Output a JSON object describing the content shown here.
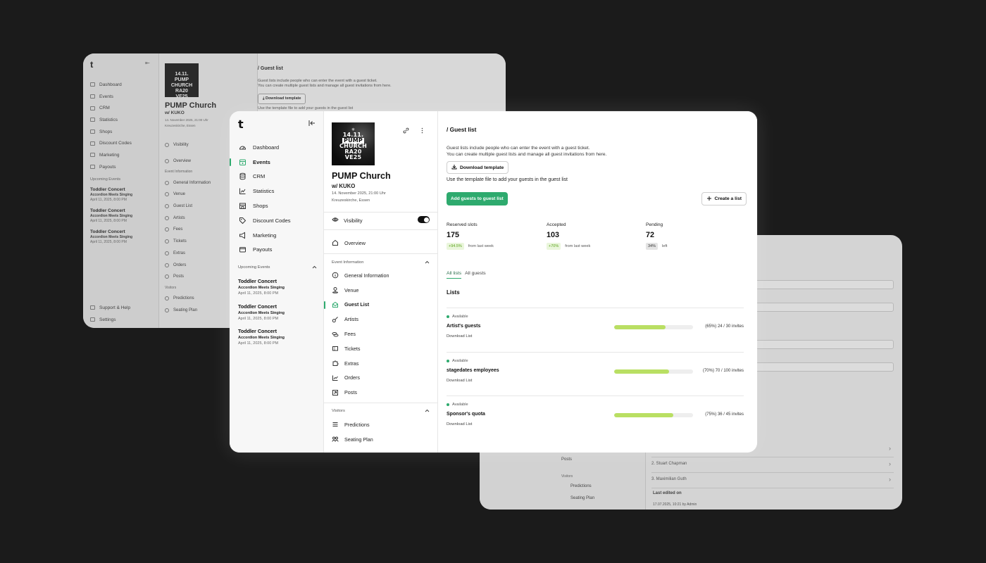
{
  "background_left": {
    "nav": [
      "Dashboard",
      "Events",
      "CRM",
      "Statistics",
      "Shops",
      "Discount Codes",
      "Marketing",
      "Payouts"
    ],
    "upcoming_heading": "Upcoming Events",
    "upcoming": [
      {
        "title": "Toddler Concert",
        "subtitle": "Accordion Meets Singing",
        "date": "April 11, 2025, 8:00 PM"
      },
      {
        "title": "Toddler Concert",
        "subtitle": "Accordion Meets Singing",
        "date": "April 11, 2025, 8:00 PM"
      },
      {
        "title": "Toddler Concert",
        "subtitle": "Accordion Meets Singing",
        "date": "April 11, 2025, 8:00 PM"
      }
    ],
    "footer": [
      "Support & Help",
      "Settings"
    ],
    "event_title": "PUMP Church",
    "event_sub": "w/ KUKO",
    "event_date": "14. November 2025, 21:00 Uhr",
    "event_place": "Kreuzeskirche, Essen",
    "event_nav": [
      "Visibility",
      "Overview",
      "Event Information",
      "General Information",
      "Venue",
      "Guest List",
      "Artists",
      "Fees",
      "Tickets",
      "Extras",
      "Orders",
      "Posts",
      "Visitors",
      "Predictions",
      "Seating Plan"
    ],
    "main_title": "/ Guest list",
    "main_desc_1": "Guest lists include people who can enter the event with a guest ticket.",
    "main_desc_2": "You can create multiple guest lists and manage all guest invitations from here.",
    "download_label": "Download template",
    "template_hint": "Use the template file to add your guests in the guest list"
  },
  "background_right": {
    "nav": [
      "Posts",
      "Visitors",
      "Predictions",
      "Seating Plan"
    ],
    "rows": [
      "2. Stuart Chapman",
      "3. Maximilian Guth"
    ],
    "last_edited_label": "Last edited on",
    "last_edited_value": "17.07.2025, 10:21 by Admin"
  },
  "sidebar": {
    "logo": "t",
    "nav": [
      {
        "label": "Dashboard",
        "icon": "dashboard-icon",
        "active": false
      },
      {
        "label": "Events",
        "icon": "calendar-icon",
        "active": true
      },
      {
        "label": "CRM",
        "icon": "database-icon",
        "active": false
      },
      {
        "label": "Statistics",
        "icon": "chart-icon",
        "active": false
      },
      {
        "label": "Shops",
        "icon": "shop-icon",
        "active": false
      },
      {
        "label": "Discount Codes",
        "icon": "tag-icon",
        "active": false
      },
      {
        "label": "Marketing",
        "icon": "megaphone-icon",
        "active": false
      },
      {
        "label": "Payouts",
        "icon": "wallet-icon",
        "active": false
      }
    ],
    "upcoming_heading": "Upcoming Events",
    "upcoming": [
      {
        "title": "Toddler Concert",
        "subtitle": "Accordion Meets Singing",
        "date": "April 11, 2025, 8:00 PM"
      },
      {
        "title": "Toddler Concert",
        "subtitle": "Accordion Meets Singing",
        "date": "April 11, 2025, 8:00 PM"
      },
      {
        "title": "Toddler Concert",
        "subtitle": "Accordion Meets Singing",
        "date": "April 11, 2025, 8:00 PM"
      }
    ]
  },
  "event": {
    "artwork_lines": [
      "14.11.",
      "PUMP",
      "CHURCH",
      "RA20",
      "VE25"
    ],
    "title": "PUMP Church",
    "subtitle": "w/ KUKO",
    "date": "14. November 2025, 21:00 Uhr",
    "place": "Kreuzeskirche, Essen",
    "visibility_label": "Visibility",
    "visibility_on": true,
    "overview_label": "Overview",
    "event_info_heading": "Event Information",
    "event_info_items": [
      {
        "label": "General Information",
        "icon": "info-icon",
        "active": false
      },
      {
        "label": "Venue",
        "icon": "location-icon",
        "active": false
      },
      {
        "label": "Guest List",
        "icon": "mail-icon",
        "active": true
      },
      {
        "label": "Artists",
        "icon": "guitar-icon",
        "active": false
      },
      {
        "label": "Fees",
        "icon": "coins-icon",
        "active": false
      },
      {
        "label": "Tickets",
        "icon": "ticket-icon",
        "active": false
      },
      {
        "label": "Extras",
        "icon": "puzzle-icon",
        "active": false
      },
      {
        "label": "Orders",
        "icon": "orders-icon",
        "active": false
      },
      {
        "label": "Posts",
        "icon": "post-icon",
        "active": false
      }
    ],
    "visitors_heading": "Visitors",
    "visitors_items": [
      {
        "label": "Predictions",
        "icon": "list-icon"
      },
      {
        "label": "Seating Plan",
        "icon": "seats-icon"
      }
    ]
  },
  "guest_list": {
    "title": "/ Guest list",
    "desc_1": "Guest lists include people who can enter the event with a guest ticket.",
    "desc_2": "You can create multiple guest lists and manage all guest invitations from here.",
    "download_label": "Download template",
    "template_hint": "Use the template file to add your guests in the guest list",
    "add_label": "Add guests to guest list",
    "create_label": "Create a list",
    "stats": [
      {
        "label": "Reserved slots",
        "value": "175",
        "badge": "+94.5%",
        "badge_style": "green",
        "note": "from last week"
      },
      {
        "label": "Accepted",
        "value": "103",
        "badge": "+70%",
        "badge_style": "green",
        "note": "from last week"
      },
      {
        "label": "Pending",
        "value": "72",
        "badge": "34%",
        "badge_style": "gray",
        "note": "left"
      }
    ],
    "tabs": [
      {
        "label": "All lists",
        "active": true
      },
      {
        "label": "All guests",
        "active": false
      }
    ],
    "lists_heading": "Lists",
    "lists": [
      {
        "status": "Available",
        "name": "Artist's guests",
        "download": "Download List",
        "fraction": 0.65,
        "summary": "(65%) 24 / 30 invites"
      },
      {
        "status": "Available",
        "name": "stagedates employees",
        "download": "Download List",
        "fraction": 0.7,
        "summary": "(70%) 70 / 100 invites"
      },
      {
        "status": "Available",
        "name": "Sponsor's quota",
        "download": "Download List",
        "fraction": 0.75,
        "summary": "(75%) 36 / 45 invites"
      }
    ]
  },
  "colors": {
    "accent": "#2eaa6e",
    "progress": "#b9df63",
    "badge_green_bg": "#eaf6dc",
    "badge_green_text": "#5aa31a"
  }
}
